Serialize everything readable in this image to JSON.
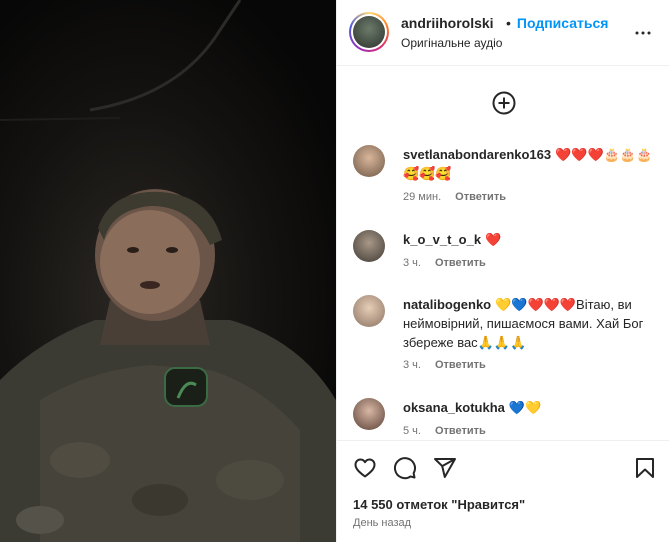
{
  "post": {
    "username": "andriihorolski",
    "follow_label": "Подписаться",
    "audio_label": "Оригінальне аудіо",
    "likes_text": "14 550 отметок \"Нравится\"",
    "date_text": "День назад"
  },
  "comments": [
    {
      "username": "svetlanabondarenko163",
      "text": "❤️❤️❤️🎂🎂🎂🥰🥰🥰",
      "time": "29 мин.",
      "reply_label": "Ответить"
    },
    {
      "username": "k_o_v_t_o_k",
      "text": "❤️",
      "time": "3 ч.",
      "reply_label": "Ответить"
    },
    {
      "username": "natalibogenko",
      "text": "💛💙❤️❤️❤️Вітаю, ви неймовірний, пишаємося вами. Хай Бог збереже вас🙏🙏🙏",
      "time": "3 ч.",
      "reply_label": "Ответить"
    },
    {
      "username": "oksana_kotukha",
      "text": "💙💛",
      "time": "5 ч.",
      "reply_label": "Ответить"
    }
  ],
  "colors": {
    "accent": "#0095f6",
    "text": "#262626",
    "muted": "#737373",
    "border": "#efefef"
  },
  "icons": [
    "more-options-icon",
    "add-comment-icon",
    "heart-icon",
    "comment-icon",
    "share-icon",
    "bookmark-icon"
  ]
}
